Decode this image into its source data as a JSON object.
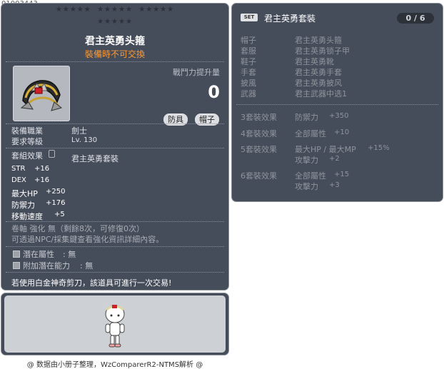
{
  "item_id": "01003443",
  "item": {
    "name": "君主英勇头箍",
    "trade_note": "裝備時不可交換",
    "power_label": "戰鬥力提升量",
    "power_value": "0",
    "tags": [
      "防具",
      "帽子"
    ]
  },
  "requirements": {
    "job_label": "裝備職業",
    "job_value": "劍士",
    "level_label": "要求等級",
    "level_value": "Lv. 130"
  },
  "set_effect": {
    "label": "套組效果",
    "value": "君主英勇套裝"
  },
  "stats": [
    {
      "name": "STR",
      "value": "+16"
    },
    {
      "name": "DEX",
      "value": "+16"
    },
    {
      "name": "最大HP",
      "value": "+250"
    },
    {
      "name": "防禦力",
      "value": "+176"
    },
    {
      "name": "移動速度",
      "value": "+5"
    }
  ],
  "enhance": {
    "line1": "卷軸 強化 無（剩餘8次，可修復0次）",
    "line2": "可透過NPC/採集鍵查看強化資訊詳細內容。"
  },
  "potential": [
    {
      "label": "潛在屬性",
      "value": ": 無"
    },
    {
      "label": "附加潛在能力",
      "value": ": 無"
    }
  ],
  "final_note": "若使用白金神奇剪刀，該道具可進行一次交易!",
  "credit": "@ 数据由小册子整理，WzComparerR2-NTMS解析 @",
  "set_panel": {
    "badge": "SET",
    "title": "君主英勇套裝",
    "count": "0 / 6",
    "parts": [
      {
        "slot": "帽子",
        "name": "君主英勇头箍"
      },
      {
        "slot": "套服",
        "name": "君主英勇锁子甲"
      },
      {
        "slot": "鞋子",
        "name": "君主英勇靴"
      },
      {
        "slot": "手套",
        "name": "君主英勇手套"
      },
      {
        "slot": "披風",
        "name": "君主英勇披风"
      },
      {
        "slot": "武器",
        "name": "君主武器中选1"
      }
    ],
    "effects": [
      {
        "label": "3套裝效果",
        "lines": [
          {
            "stat": "防禦力",
            "value": "+350"
          }
        ]
      },
      {
        "label": "4套裝效果",
        "lines": [
          {
            "stat": "全部屬性",
            "value": "+10"
          }
        ]
      },
      {
        "label": "5套裝效果",
        "lines": [
          {
            "stat": "最大HP / 最大MP",
            "value": "+15%"
          },
          {
            "stat": "攻擊力",
            "value": "+2"
          }
        ]
      },
      {
        "label": "6套裝效果",
        "lines": [
          {
            "stat": "全部屬性",
            "value": "+15"
          },
          {
            "stat": "攻擊力",
            "value": "+3"
          }
        ]
      }
    ]
  },
  "colors": {
    "panel_bg": "#454c5a",
    "trade_note": "#ff9a35",
    "dim_text": "#8f949c"
  }
}
